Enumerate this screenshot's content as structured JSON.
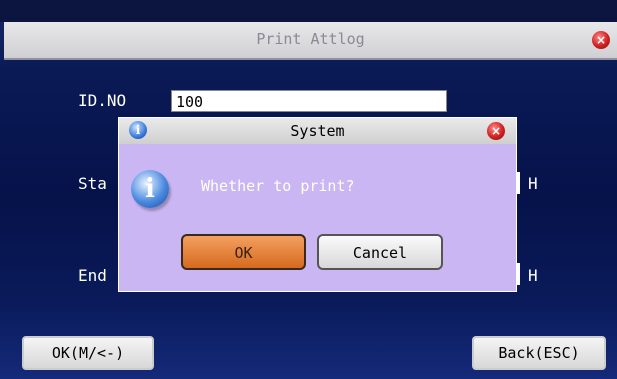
{
  "window": {
    "title": "Print Attlog"
  },
  "form": {
    "id_label": "ID.NO",
    "id_value": "100",
    "start_label": "Sta",
    "end_label": "End",
    "start_hour_unit": "H",
    "end_hour_unit": "H"
  },
  "dialog": {
    "title": "System",
    "message": "Whether to print?",
    "ok_label": "OK",
    "cancel_label": "Cancel"
  },
  "footer": {
    "ok_label": "OK(M/<-)",
    "back_label": "Back(ESC)"
  },
  "icons": {
    "close": "close-icon",
    "info": "info-icon"
  }
}
